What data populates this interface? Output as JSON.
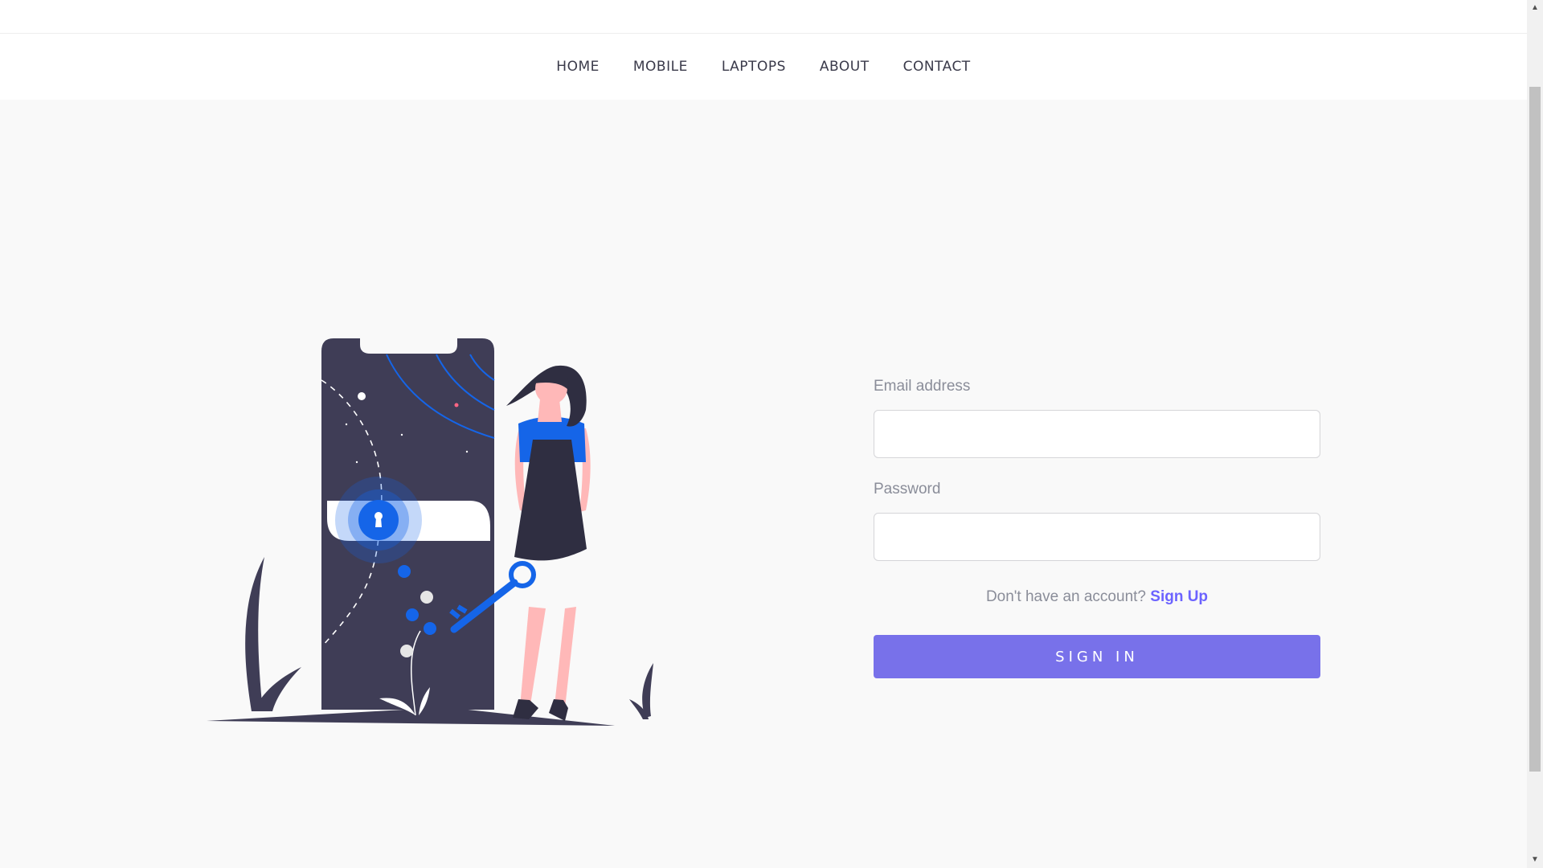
{
  "nav": {
    "items": [
      {
        "label": "HOME"
      },
      {
        "label": "MOBILE"
      },
      {
        "label": "LAPTOPS"
      },
      {
        "label": "ABOUT"
      },
      {
        "label": "CONTACT"
      }
    ]
  },
  "illustration": {
    "icons": [
      "phone-icon",
      "lock-icon",
      "key-icon",
      "person-figure"
    ]
  },
  "login": {
    "email_label": "Email address",
    "email_value": "",
    "password_label": "Password",
    "password_value": "",
    "signup_prompt": "Don't have an account?",
    "signup_link": "Sign Up",
    "signin_label": "SIGN IN"
  },
  "colors": {
    "accent": "#7871ea",
    "link": "#6c63ff",
    "illustration_dark": "#3f3d56",
    "illustration_blue": "#1565e8",
    "skin": "#ffb8b8"
  },
  "scrollbar": {
    "up_icon": "scroll-up-arrow-icon",
    "down_icon": "scroll-down-arrow-icon"
  }
}
